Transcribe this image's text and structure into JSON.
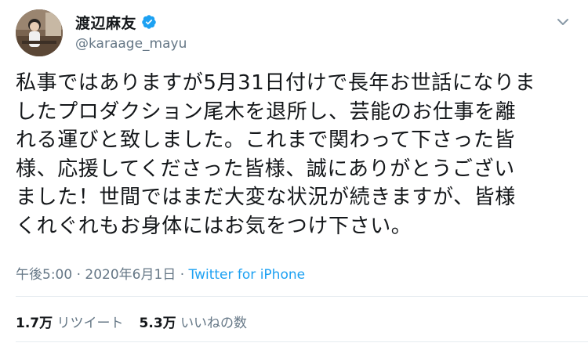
{
  "user": {
    "display_name": "渡辺麻友",
    "handle": "@karaage_mayu",
    "verified": true
  },
  "icons": {
    "verified": "verified-badge-icon",
    "caret": "chevron-down-icon"
  },
  "tweet": {
    "text": "私事ではありますが5月31日付けで長年お世話になりま\nしたプロダクション尾木を退所し、芸能のお仕事を離\nれる運びと致しました。これまで関わって下さった皆\n様、応援してくださった皆様、誠にありがとうござい\nました！世間ではまだ大変な状況が続きますが、皆様\nくれぐれもお身体にはお気をつけ下さい。",
    "time": "午後5:00",
    "separator1": " · ",
    "date": "2020年6月1日",
    "separator2": " · ",
    "source": "Twitter for iPhone"
  },
  "stats": {
    "retweets_count": "1.7万",
    "retweets_label": "リツイート",
    "likes_count": "5.3万",
    "likes_label": "いいねの数"
  },
  "colors": {
    "accent": "#1da1f2",
    "text": "#14171a",
    "muted": "#657786",
    "border": "#e6ecf0"
  }
}
